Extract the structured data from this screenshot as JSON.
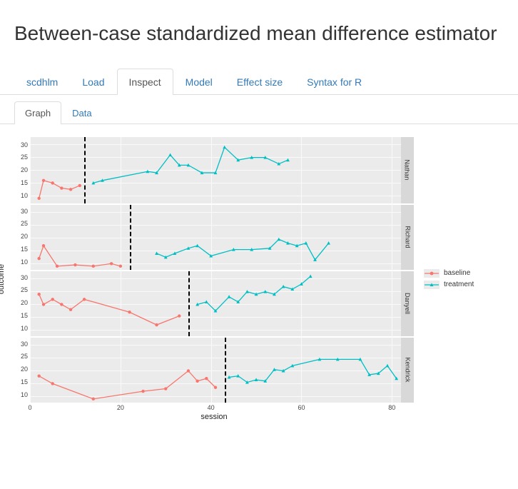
{
  "title": "Between-case standardized mean difference estimator",
  "tabs": [
    "scdhlm",
    "Load",
    "Inspect",
    "Model",
    "Effect size",
    "Syntax for R"
  ],
  "active_tab": 2,
  "subtabs": [
    "Graph",
    "Data"
  ],
  "active_subtab": 0,
  "legend": {
    "items": [
      {
        "label": "baseline",
        "color": "#f8766d",
        "shape": "circle"
      },
      {
        "label": "treatment",
        "color": "#00bfc4",
        "shape": "triangle"
      }
    ]
  },
  "axes": {
    "xlabel": "session",
    "ylabel": "outcome",
    "x_ticks": [
      0,
      20,
      40,
      60,
      80
    ],
    "y_ticks": [
      10,
      15,
      20,
      25,
      30
    ],
    "x_range": [
      0,
      82
    ],
    "y_range": [
      7,
      33
    ]
  },
  "colors": {
    "baseline": "#f8766d",
    "treatment": "#00bfc4",
    "panel_bg": "#ebebeb",
    "strip_bg": "#d8d8d8"
  },
  "chart_data": [
    {
      "facet": "Nathan",
      "vline_x": 12,
      "series": [
        {
          "name": "baseline",
          "x": [
            2,
            3,
            5,
            7,
            9,
            11
          ],
          "y": [
            9,
            16,
            15,
            13,
            12.5,
            14
          ]
        },
        {
          "name": "treatment",
          "x": [
            14,
            16,
            26,
            28,
            31,
            33,
            35,
            38,
            41,
            43,
            46,
            49,
            52,
            55,
            57
          ],
          "y": [
            15,
            16,
            19.5,
            19,
            26,
            22,
            22,
            19,
            19,
            29,
            24,
            25,
            25,
            22.5,
            24
          ]
        }
      ]
    },
    {
      "facet": "Richard",
      "vline_x": 22,
      "series": [
        {
          "name": "baseline",
          "x": [
            2,
            3,
            6,
            10,
            14,
            18,
            20
          ],
          "y": [
            12,
            17,
            9,
            9.5,
            9,
            10,
            9
          ]
        },
        {
          "name": "treatment",
          "x": [
            28,
            30,
            32,
            35,
            37,
            40,
            45,
            49,
            53,
            55,
            57,
            59,
            61,
            63,
            66
          ],
          "y": [
            14,
            12.5,
            14,
            16,
            17,
            13,
            15.5,
            15.5,
            16,
            19.5,
            18,
            17,
            18,
            11.5,
            18
          ]
        }
      ]
    },
    {
      "facet": "Danyell",
      "vline_x": 35,
      "series": [
        {
          "name": "baseline",
          "x": [
            2,
            3,
            5,
            7,
            9,
            12,
            22,
            28,
            33
          ],
          "y": [
            24,
            20,
            22,
            20,
            18,
            22,
            17,
            12,
            15.5
          ]
        },
        {
          "name": "treatment",
          "x": [
            37,
            39,
            41,
            44,
            46,
            48,
            50,
            52,
            54,
            56,
            58,
            60,
            62
          ],
          "y": [
            20,
            21,
            17.5,
            23,
            21,
            25,
            24,
            25,
            24,
            27,
            26,
            28,
            31
          ]
        }
      ]
    },
    {
      "facet": "Kendrick",
      "vline_x": 43,
      "series": [
        {
          "name": "baseline",
          "x": [
            2,
            5,
            14,
            25,
            30,
            35,
            37,
            39,
            41
          ],
          "y": [
            18,
            15,
            9,
            12,
            13,
            20,
            16,
            17,
            13.5
          ]
        },
        {
          "name": "treatment",
          "x": [
            44,
            46,
            48,
            50,
            52,
            54,
            56,
            58,
            64,
            68,
            73,
            75,
            77,
            79,
            81
          ],
          "y": [
            17.5,
            18,
            15.5,
            16.5,
            16,
            20.5,
            20,
            22,
            24.5,
            24.5,
            24.5,
            18.5,
            19,
            22,
            17
          ]
        }
      ]
    }
  ]
}
